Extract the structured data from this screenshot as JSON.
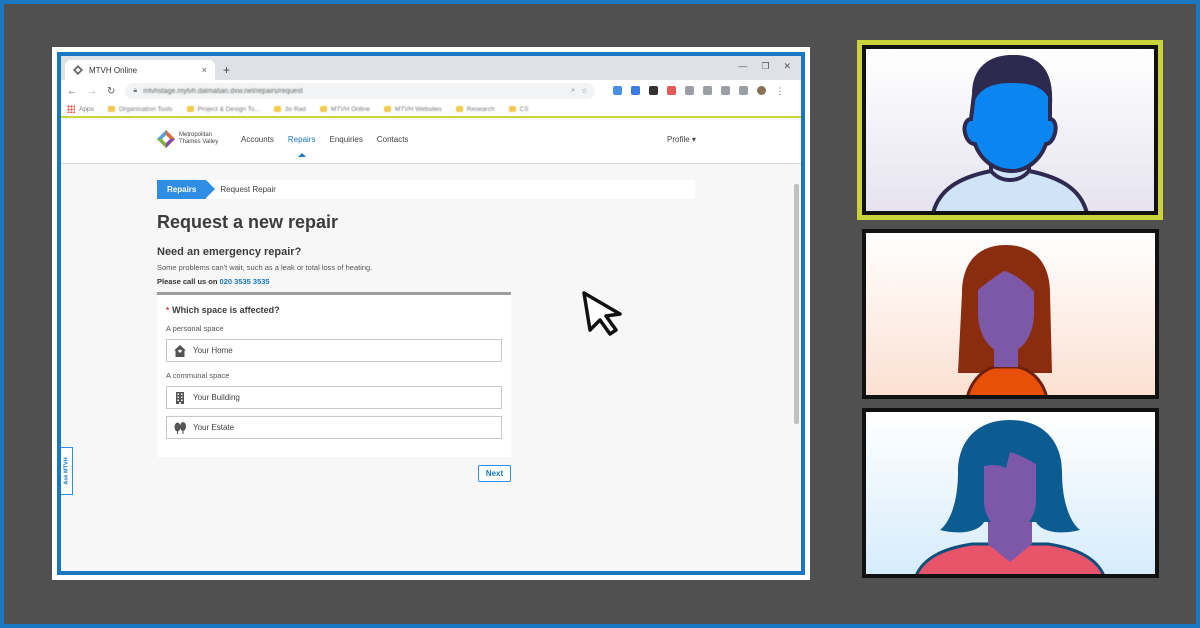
{
  "browser": {
    "tab_title": "MTVH Online",
    "tab_close": "×",
    "new_tab": "+",
    "window_controls": [
      "—",
      "❐",
      "✕"
    ],
    "url": "mtvhstage.mytvh.dalmatian.dxw.net/repairs/request",
    "bookmarks": [
      "Apps",
      "Organisation Tools",
      "Project & Design To...",
      "3o Rad",
      "MTVH Online",
      "MTVH Websites",
      "Research",
      "CS"
    ]
  },
  "site": {
    "logo_line1": "Metropolitan",
    "logo_line2": "Thames Valley",
    "nav": [
      "Accounts",
      "Repairs",
      "Enquiries",
      "Contacts"
    ],
    "profile": "Profile ▾",
    "breadcrumb": {
      "active": "Repairs",
      "current": "Request Repair"
    },
    "page_title": "Request a new repair",
    "emergency_title": "Need an emergency repair?",
    "emergency_text": "Some problems can't wait, such as a leak or total loss of heating.",
    "call_prefix": "Please call us on",
    "phone": "020 3535 3535",
    "question_required_mark": "*",
    "question": "Which space is affected?",
    "group_personal": "A personal space",
    "group_communal": "A communal space",
    "options": [
      "Your Home",
      "Your Building",
      "Your Estate"
    ],
    "next_label": "Next",
    "ask_tab": "Ask MTVH"
  },
  "colors": {
    "accent": "#1a78c2",
    "breadcrumb_active": "#2f8de4",
    "tile_highlight": "#c9d33a",
    "background": "#505050"
  },
  "icons": [
    "home-icon",
    "building-icon",
    "trees-icon",
    "cursor-arrow-icon"
  ]
}
